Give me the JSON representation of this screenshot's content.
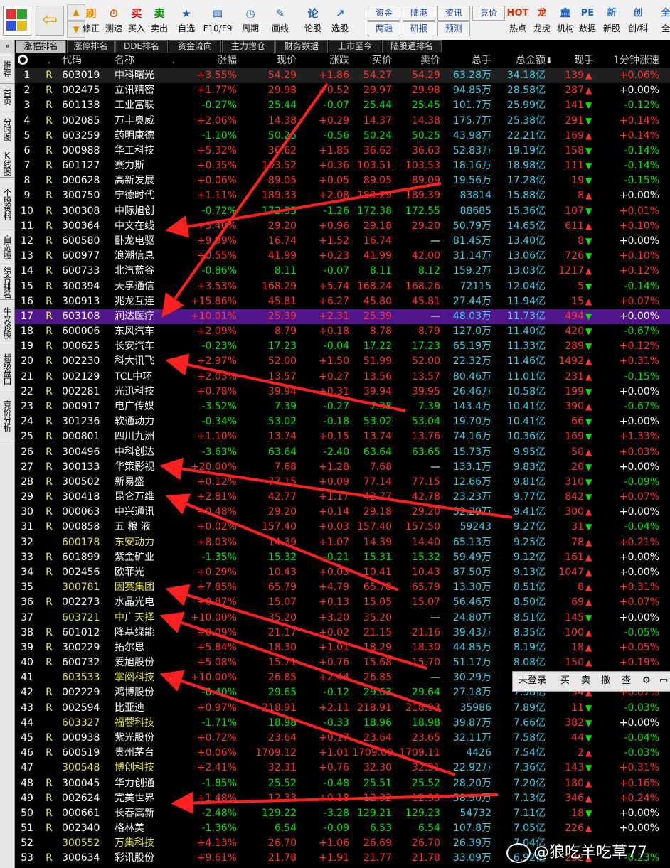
{
  "toolbar": {
    "buttons": [
      {
        "label": "修正",
        "icon": "刷",
        "color": "#e89000"
      },
      {
        "label": "测速",
        "icon": "⏱",
        "color": "#d06000"
      },
      {
        "label": "买入",
        "icon": "买",
        "color": "#e00000"
      },
      {
        "label": "卖出",
        "icon": "卖",
        "color": "#009000"
      },
      {
        "label": "自选",
        "icon": "★",
        "color": "#2060c0"
      },
      {
        "label": "F10/F9",
        "icon": "▤",
        "color": "#2060c0"
      },
      {
        "label": "周期",
        "icon": "◷",
        "color": "#2060c0"
      },
      {
        "label": "画线",
        "icon": "✎",
        "color": "#2060c0"
      },
      {
        "label": "论股",
        "icon": "论",
        "color": "#2060c0"
      },
      {
        "label": "选股",
        "icon": "↗",
        "color": "#2060c0"
      }
    ],
    "mini_buttons": [
      "资金",
      "陆港",
      "资讯",
      "竞价",
      "两融",
      "研报",
      "预测"
    ],
    "right_buttons": [
      {
        "label": "热点",
        "icon": "HOT",
        "color": "#e03000"
      },
      {
        "label": "龙虎",
        "icon": "龙",
        "color": "#e03000"
      },
      {
        "label": "机构",
        "icon": "🏛",
        "color": "#2060c0"
      },
      {
        "label": "数据",
        "icon": "PE",
        "color": "#2060c0"
      },
      {
        "label": "新股",
        "icon": "新",
        "color": "#2060c0"
      },
      {
        "label": "创/科",
        "icon": "创",
        "color": "#2060c0"
      },
      {
        "label": "全",
        "icon": "全",
        "color": "#2060c0"
      }
    ]
  },
  "tabs": [
    "涨幅排名",
    "涨停排名",
    "DDE排名",
    "资金流向",
    "主力增仓",
    "财务数据",
    "上市至今",
    "陆股通排名"
  ],
  "sidebar": [
    "推荐",
    "首页",
    "分时图",
    "K线图",
    "个股资料",
    "自选股",
    "综合排名",
    "牛叉诊股",
    "超级盘口",
    "竞价分析"
  ],
  "columns": [
    "",
    ".",
    "代码",
    "名称",
    ".",
    "涨幅",
    "现价",
    "涨跌",
    "买价",
    "卖价",
    "总手",
    "总金额",
    "现手",
    "1分钟涨速"
  ],
  "sort_marker": "⬇",
  "rows": [
    {
      "i": "1",
      "r": "R",
      "code": "603019",
      "name": "中科曙光",
      "pct": "+3.55%",
      "price": "54.29",
      "chg": "+1.86",
      "bid": "54.27",
      "ask": "54.29",
      "vol": "63.28万",
      "amt": "34.18亿",
      "cur": "139",
      "dir": "up",
      "speed": "+0.06%"
    },
    {
      "i": "2",
      "r": "R",
      "code": "002475",
      "name": "立讯精密",
      "pct": "+1.77%",
      "price": "29.98",
      "chg": "+0.52",
      "bid": "29.97",
      "ask": "29.98",
      "vol": "94.85万",
      "amt": "28.58亿",
      "cur": "287",
      "dir": "up",
      "speed": "+0.00%"
    },
    {
      "i": "3",
      "r": "R",
      "code": "601138",
      "name": "工业富联",
      "pct": "-0.27%",
      "price": "25.44",
      "chg": "-0.07",
      "bid": "25.44",
      "ask": "25.45",
      "vol": "101.7万",
      "amt": "25.99亿",
      "cur": "141",
      "dir": "dn",
      "speed": "-0.12%"
    },
    {
      "i": "4",
      "r": "R",
      "code": "002085",
      "name": "万丰奥威",
      "pct": "+2.06%",
      "price": "14.38",
      "chg": "+0.29",
      "bid": "14.37",
      "ask": "14.38",
      "vol": "175.7万",
      "amt": "25.38亿",
      "cur": "291",
      "dir": "dn",
      "speed": "+0.14%"
    },
    {
      "i": "5",
      "r": "R",
      "code": "603259",
      "name": "药明康德",
      "pct": "-1.10%",
      "price": "50.25",
      "chg": "-0.56",
      "bid": "50.24",
      "ask": "50.25",
      "vol": "43.98万",
      "amt": "22.21亿",
      "cur": "169",
      "dir": "up",
      "speed": "+0.14%"
    },
    {
      "i": "6",
      "r": "R",
      "code": "000988",
      "name": "华工科技",
      "pct": "+5.32%",
      "price": "36.62",
      "chg": "+1.85",
      "bid": "36.62",
      "ask": "36.63",
      "vol": "52.83万",
      "amt": "19.19亿",
      "cur": "158",
      "dir": "dn",
      "speed": "-0.14%"
    },
    {
      "i": "7",
      "r": "R",
      "code": "601127",
      "name": "赛力斯",
      "pct": "+0.35%",
      "price": "103.52",
      "chg": "+0.36",
      "bid": "103.51",
      "ask": "103.53",
      "vol": "18.16万",
      "amt": "18.98亿",
      "cur": "111",
      "dir": "dn",
      "speed": "-0.14%"
    },
    {
      "i": "8",
      "r": "R",
      "code": "000628",
      "name": "高新发展",
      "pct": "+0.06%",
      "price": "89.05",
      "chg": "+0.05",
      "bid": "89.05",
      "ask": "89.09",
      "vol": "19.56万",
      "amt": "17.28亿",
      "cur": "19",
      "dir": "dn",
      "speed": "-0.15%"
    },
    {
      "i": "9",
      "r": "R",
      "code": "300750",
      "name": "宁德时代",
      "pct": "+1.11%",
      "price": "189.33",
      "chg": "+2.08",
      "bid": "189.29",
      "ask": "189.39",
      "vol": "83814",
      "amt": "15.88亿",
      "cur": "8",
      "dir": "up",
      "speed": "+0.00%"
    },
    {
      "i": "10",
      "r": "R",
      "code": "300308",
      "name": "中际旭创",
      "pct": "-0.72%",
      "price": "172.35",
      "chg": "-1.26",
      "bid": "172.38",
      "ask": "172.55",
      "vol": "88685",
      "amt": "15.36亿",
      "cur": "107",
      "dir": "dn",
      "speed": "+0.01%"
    },
    {
      "i": "11",
      "r": "R",
      "code": "300364",
      "name": "中文在线",
      "pct": "+3.40%",
      "price": "29.20",
      "chg": "+0.96",
      "bid": "29.18",
      "ask": "29.20",
      "vol": "50.79万",
      "amt": "14.65亿",
      "cur": "611",
      "dir": "up",
      "speed": "+0.10%"
    },
    {
      "i": "12",
      "r": "R",
      "code": "600580",
      "name": "卧龙电驱",
      "pct": "+9.99%",
      "price": "16.74",
      "chg": "+1.52",
      "bid": "16.74",
      "ask": "—",
      "vol": "81.45万",
      "amt": "13.40亿",
      "cur": "8",
      "dir": "dn",
      "speed": "+0.00%"
    },
    {
      "i": "13",
      "r": "R",
      "code": "600977",
      "name": "浪潮信息",
      "pct": "+0.55%",
      "price": "41.99",
      "chg": "+0.23",
      "bid": "41.99",
      "ask": "42.00",
      "vol": "31.14万",
      "amt": "13.06亿",
      "cur": "726",
      "dir": "dn",
      "speed": "+0.10%"
    },
    {
      "i": "14",
      "r": "R",
      "code": "600733",
      "name": "北汽蓝谷",
      "pct": "-0.86%",
      "price": "8.11",
      "chg": "-0.07",
      "bid": "8.11",
      "ask": "8.12",
      "vol": "159.2万",
      "amt": "13.03亿",
      "cur": "1217",
      "dir": "up",
      "speed": "+0.12%"
    },
    {
      "i": "15",
      "r": "R",
      "code": "300394",
      "name": "天孚通信",
      "pct": "+3.53%",
      "price": "168.29",
      "chg": "+5.74",
      "bid": "168.24",
      "ask": "168.26",
      "vol": "72115",
      "amt": "12.04亿",
      "cur": "5",
      "dir": "dn",
      "speed": "-0.14%"
    },
    {
      "i": "16",
      "r": "R",
      "code": "300913",
      "name": "兆龙互连",
      "pct": "+15.86%",
      "price": "45.81",
      "chg": "+6.27",
      "bid": "45.80",
      "ask": "45.81",
      "vol": "27.44万",
      "amt": "11.94亿",
      "cur": "15",
      "dir": "up",
      "speed": "+0.07%"
    },
    {
      "i": "17",
      "r": "R",
      "code": "603108",
      "name": "润达医疗",
      "pct": "+10.01%",
      "price": "25.39",
      "chg": "+2.31",
      "bid": "25.39",
      "ask": "—",
      "vol": "48.03万",
      "amt": "11.73亿",
      "cur": "494",
      "dir": "dn",
      "speed": "+0.00%"
    },
    {
      "i": "18",
      "r": "R",
      "code": "600006",
      "name": "东风汽车",
      "pct": "+2.09%",
      "price": "8.79",
      "chg": "+0.18",
      "bid": "8.78",
      "ask": "8.79",
      "vol": "127.0万",
      "amt": "11.40亿",
      "cur": "420",
      "dir": "dn",
      "speed": "-0.67%"
    },
    {
      "i": "19",
      "r": "R",
      "code": "000625",
      "name": "长安汽车",
      "pct": "-0.23%",
      "price": "17.23",
      "chg": "-0.04",
      "bid": "17.22",
      "ask": "17.23",
      "vol": "65.19万",
      "amt": "11.33亿",
      "cur": "289",
      "dir": "dn",
      "speed": "+0.12%"
    },
    {
      "i": "20",
      "r": "R",
      "code": "002230",
      "name": "科大讯飞",
      "pct": "+2.97%",
      "price": "52.00",
      "chg": "+1.50",
      "bid": "51.99",
      "ask": "52.00",
      "vol": "22.32万",
      "amt": "11.46亿",
      "cur": "1492",
      "dir": "up",
      "speed": "+0.31%"
    },
    {
      "i": "21",
      "r": "R",
      "code": "002129",
      "name": "TCL中环",
      "pct": "+2.03%",
      "price": "13.57",
      "chg": "+0.27",
      "bid": "13.56",
      "ask": "13.57",
      "vol": "80.46万",
      "amt": "11.01亿",
      "cur": "231",
      "dir": "up",
      "speed": "-0.15%"
    },
    {
      "i": "22",
      "r": "R",
      "code": "002281",
      "name": "光迅科技",
      "pct": "+0.78%",
      "price": "39.94",
      "chg": "+0.31",
      "bid": "39.94",
      "ask": "39.95",
      "vol": "26.46万",
      "amt": "10.58亿",
      "cur": "199",
      "dir": "dn",
      "speed": "+0.00%"
    },
    {
      "i": "23",
      "r": "R",
      "code": "000917",
      "name": "电广传媒",
      "pct": "-3.52%",
      "price": "7.39",
      "chg": "-0.27",
      "bid": "7.38",
      "ask": "7.39",
      "vol": "143.4万",
      "amt": "10.41亿",
      "cur": "390",
      "dir": "up",
      "speed": "-0.67%"
    },
    {
      "i": "24",
      "r": "R",
      "code": "301236",
      "name": "软通动力",
      "pct": "-0.34%",
      "price": "53.02",
      "chg": "-0.18",
      "bid": "53.02",
      "ask": "53.04",
      "vol": "19.70万",
      "amt": "10.41亿",
      "cur": "66",
      "dir": "dn",
      "speed": "+0.00%"
    },
    {
      "i": "25",
      "r": "R",
      "code": "000801",
      "name": "四川九洲",
      "pct": "+1.10%",
      "price": "13.74",
      "chg": "+0.15",
      "bid": "13.74",
      "ask": "13.76",
      "vol": "74.16万",
      "amt": "10.36亿",
      "cur": "169",
      "dir": "dn",
      "speed": "+1.33%"
    },
    {
      "i": "26",
      "r": "R",
      "code": "300496",
      "name": "中科创达",
      "pct": "-3.63%",
      "price": "63.64",
      "chg": "-2.40",
      "bid": "63.64",
      "ask": "63.65",
      "vol": "15.73万",
      "amt": "9.95亿",
      "cur": "50",
      "dir": "up",
      "speed": "+0.03%"
    },
    {
      "i": "27",
      "r": "R",
      "code": "300133",
      "name": "华策影视",
      "pct": "+20.00%",
      "price": "7.68",
      "chg": "+1.28",
      "bid": "7.68",
      "ask": "—",
      "vol": "133.1万",
      "amt": "9.83亿",
      "cur": "20",
      "dir": "dn",
      "speed": "+0.00%"
    },
    {
      "i": "28",
      "r": "R",
      "code": "300502",
      "name": "新易盛",
      "pct": "+0.12%",
      "price": "77.15",
      "chg": "+0.09",
      "bid": "77.14",
      "ask": "77.15",
      "vol": "12.66万",
      "amt": "9.81亿",
      "cur": "310",
      "dir": "dn",
      "speed": "-0.09%"
    },
    {
      "i": "29",
      "r": "R",
      "code": "300418",
      "name": "昆仑万维",
      "pct": "+2.81%",
      "price": "42.77",
      "chg": "+1.17",
      "bid": "42.77",
      "ask": "42.78",
      "vol": "23.23万",
      "amt": "9.77亿",
      "cur": "842",
      "dir": "dn",
      "speed": "+0.07%"
    },
    {
      "i": "30",
      "r": "R",
      "code": "000063",
      "name": "中兴通讯",
      "pct": "+0.48%",
      "price": "29.20",
      "chg": "+0.14",
      "bid": "29.18",
      "ask": "29.20",
      "vol": "32.29万",
      "amt": "9.41亿",
      "cur": "300",
      "dir": "up",
      "speed": "+0.00%"
    },
    {
      "i": "31",
      "r": "R",
      "code": "000858",
      "name": "五 粮 液",
      "pct": "+0.02%",
      "price": "157.40",
      "chg": "+0.03",
      "bid": "157.40",
      "ask": "157.50",
      "vol": "59243",
      "amt": "9.27亿",
      "cur": "31",
      "dir": "dn",
      "speed": "-0.04%"
    },
    {
      "i": "32",
      "r": "",
      "code": "600178",
      "name": "东安动力",
      "pct": "+8.03%",
      "price": "14.39",
      "chg": "+1.07",
      "bid": "14.39",
      "ask": "14.40",
      "vol": "65.13万",
      "amt": "9.25亿",
      "cur": "78",
      "dir": "up",
      "speed": "+0.21%"
    },
    {
      "i": "33",
      "r": "R",
      "code": "601899",
      "name": "紫金矿业",
      "pct": "-1.35%",
      "price": "15.32",
      "chg": "-0.21",
      "bid": "15.31",
      "ask": "15.32",
      "vol": "59.49万",
      "amt": "9.12亿",
      "cur": "161",
      "dir": "up",
      "speed": "+0.00%"
    },
    {
      "i": "34",
      "r": "R",
      "code": "002456",
      "name": "欧菲光",
      "pct": "+0.29%",
      "price": "10.43",
      "chg": "+0.03",
      "bid": "10.41",
      "ask": "10.43",
      "vol": "87.50万",
      "amt": "9.13亿",
      "cur": "1047",
      "dir": "up",
      "speed": "+0.00%"
    },
    {
      "i": "35",
      "r": "",
      "code": "300781",
      "name": "因赛集团",
      "pct": "+7.85%",
      "price": "65.79",
      "chg": "+4.79",
      "bid": "65.78",
      "ask": "65.79",
      "vol": "13.30万",
      "amt": "8.51亿",
      "cur": "8",
      "dir": "up",
      "speed": "+0.31%"
    },
    {
      "i": "36",
      "r": "R",
      "code": "002273",
      "name": "水晶光电",
      "pct": "+0.87%",
      "price": "15.07",
      "chg": "+0.13",
      "bid": "15.05",
      "ask": "15.07",
      "vol": "56.46万",
      "amt": "8.50亿",
      "cur": "69",
      "dir": "up",
      "speed": "+0.07%"
    },
    {
      "i": "37",
      "r": "",
      "code": "603721",
      "name": "中广天择",
      "pct": "+10.00%",
      "price": "35.20",
      "chg": "+3.20",
      "bid": "35.20",
      "ask": "—",
      "vol": "24.80万",
      "amt": "8.51亿",
      "cur": "145",
      "dir": "dn",
      "speed": "+0.00%"
    },
    {
      "i": "38",
      "r": "R",
      "code": "601012",
      "name": "隆基绿能",
      "pct": "+0.09%",
      "price": "21.17",
      "chg": "+0.02",
      "bid": "21.15",
      "ask": "21.16",
      "vol": "39.43万",
      "amt": "8.35亿",
      "cur": "100",
      "dir": "up",
      "speed": "-0.05%"
    },
    {
      "i": "39",
      "r": "R",
      "code": "300229",
      "name": "拓尔思",
      "pct": "+5.84%",
      "price": "18.30",
      "chg": "+1.01",
      "bid": "18.29",
      "ask": "18.30",
      "vol": "44.85万",
      "amt": "8.19亿",
      "cur": "18",
      "dir": "up",
      "speed": "+0.05%"
    },
    {
      "i": "40",
      "r": "R",
      "code": "600732",
      "name": "爱旭股份",
      "pct": "+5.08%",
      "price": "15.71",
      "chg": "+0.76",
      "bid": "15.68",
      "ask": "15.70",
      "vol": "51.17万",
      "amt": "8.08亿",
      "cur": "150",
      "dir": "up",
      "speed": "+0.19%"
    },
    {
      "i": "41",
      "r": "",
      "code": "603533",
      "name": "掌阅科技",
      "pct": "+10.00%",
      "price": "26.85",
      "chg": "+2.44",
      "bid": "26.85",
      "ask": "—",
      "vol": "30.29万",
      "amt": "8.09亿",
      "cur": "",
      "dir": "",
      "speed": ""
    },
    {
      "i": "42",
      "r": "R",
      "code": "002229",
      "name": "鸿博股份",
      "pct": "-0.40%",
      "price": "29.65",
      "chg": "-0.12",
      "bid": "29.63",
      "ask": "29.64",
      "vol": "27.18万",
      "amt": "7.98亿",
      "cur": "94",
      "dir": "up",
      "speed": "+0.07%"
    },
    {
      "i": "43",
      "r": "R",
      "code": "002594",
      "name": "比亚迪",
      "pct": "+0.97%",
      "price": "218.91",
      "chg": "+2.11",
      "bid": "218.91",
      "ask": "218.93",
      "vol": "35986",
      "amt": "7.89亿",
      "cur": "11",
      "dir": "dn",
      "speed": "-0.03%"
    },
    {
      "i": "44",
      "r": "",
      "code": "603327",
      "name": "福蓉科技",
      "pct": "-1.71%",
      "price": "18.98",
      "chg": "-0.33",
      "bid": "18.96",
      "ask": "18.98",
      "vol": "39.87万",
      "amt": "7.66亿",
      "cur": "382",
      "dir": "dn",
      "speed": "+0.00%"
    },
    {
      "i": "45",
      "r": "R",
      "code": "000938",
      "name": "紫光股份",
      "pct": "+0.72%",
      "price": "23.64",
      "chg": "+0.17",
      "bid": "23.64",
      "ask": "23.65",
      "vol": "32.11万",
      "amt": "7.58亿",
      "cur": "44",
      "dir": "dn",
      "speed": "-0.04%"
    },
    {
      "i": "46",
      "r": "R",
      "code": "600519",
      "name": "贵州茅台",
      "pct": "+0.06%",
      "price": "1709.12",
      "chg": "+1.01",
      "bid": "1709.00",
      "ask": "1709.11",
      "vol": "4426",
      "amt": "7.54亿",
      "cur": "2",
      "dir": "up",
      "speed": "-0.03%"
    },
    {
      "i": "47",
      "r": "",
      "code": "300548",
      "name": "博创科技",
      "pct": "+2.41%",
      "price": "32.31",
      "chg": "+0.76",
      "bid": "32.30",
      "ask": "32.31",
      "vol": "22.92万",
      "amt": "7.36亿",
      "cur": "143",
      "dir": "dn",
      "speed": "+0.31%"
    },
    {
      "i": "48",
      "r": "R",
      "code": "300045",
      "name": "华力创通",
      "pct": "-1.85%",
      "price": "25.52",
      "chg": "-0.48",
      "bid": "25.51",
      "ask": "25.52",
      "vol": "28.20万",
      "amt": "7.20亿",
      "cur": "180",
      "dir": "up",
      "speed": "+0.16%"
    },
    {
      "i": "49",
      "r": "R",
      "code": "002624",
      "name": "完美世界",
      "pct": "+1.48%",
      "price": "12.33",
      "chg": "+0.18",
      "bid": "12.32",
      "ask": "12.33",
      "vol": "58.90万",
      "amt": "7.13亿",
      "cur": "346",
      "dir": "up",
      "speed": "+0.24%"
    },
    {
      "i": "50",
      "r": "R",
      "code": "000661",
      "name": "长春高新",
      "pct": "-2.48%",
      "price": "129.22",
      "chg": "-3.28",
      "bid": "129.21",
      "ask": "129.23",
      "vol": "54732",
      "amt": "7.11亿",
      "cur": "18",
      "dir": "dn",
      "speed": "+0.00%"
    },
    {
      "i": "51",
      "r": "R",
      "code": "002340",
      "name": "格林美",
      "pct": "-1.36%",
      "price": "6.54",
      "chg": "-0.09",
      "bid": "6.53",
      "ask": "6.54",
      "vol": "107.8万",
      "amt": "7.05亿",
      "cur": "226",
      "dir": "up",
      "speed": "+0.00%"
    },
    {
      "i": "52",
      "r": "",
      "code": "300552",
      "name": "万集科技",
      "pct": "+4.13%",
      "price": "26.70",
      "chg": "+1.06",
      "bid": "26.69",
      "ask": "26.70",
      "vol": "26.39万",
      "amt": "7.04亿",
      "cur": "",
      "dir": "",
      "speed": ""
    },
    {
      "i": "53",
      "r": "R",
      "code": "300634",
      "name": "彩讯股份",
      "pct": "+9.61%",
      "price": "21.78",
      "chg": "+1.91",
      "bid": "21.77",
      "ask": "21.78",
      "vol": "33.09万",
      "amt": "6.92亿",
      "cur": "232",
      "dir": "up",
      "speed": "-0.23%"
    }
  ],
  "trade_bar": {
    "login": "未登录",
    "buy": "买",
    "sell": "卖",
    "cancel": "撤",
    "query": "查"
  },
  "watermark": "@狼吃羊吃草77",
  "colors": {
    "up": "#ff3232",
    "down": "#00e600",
    "flat": "#ffffff",
    "sh_code": "#e8e850",
    "vol": "#3cd0e8",
    "selected_row": "#50168a",
    "arrow": "#ff2020"
  }
}
